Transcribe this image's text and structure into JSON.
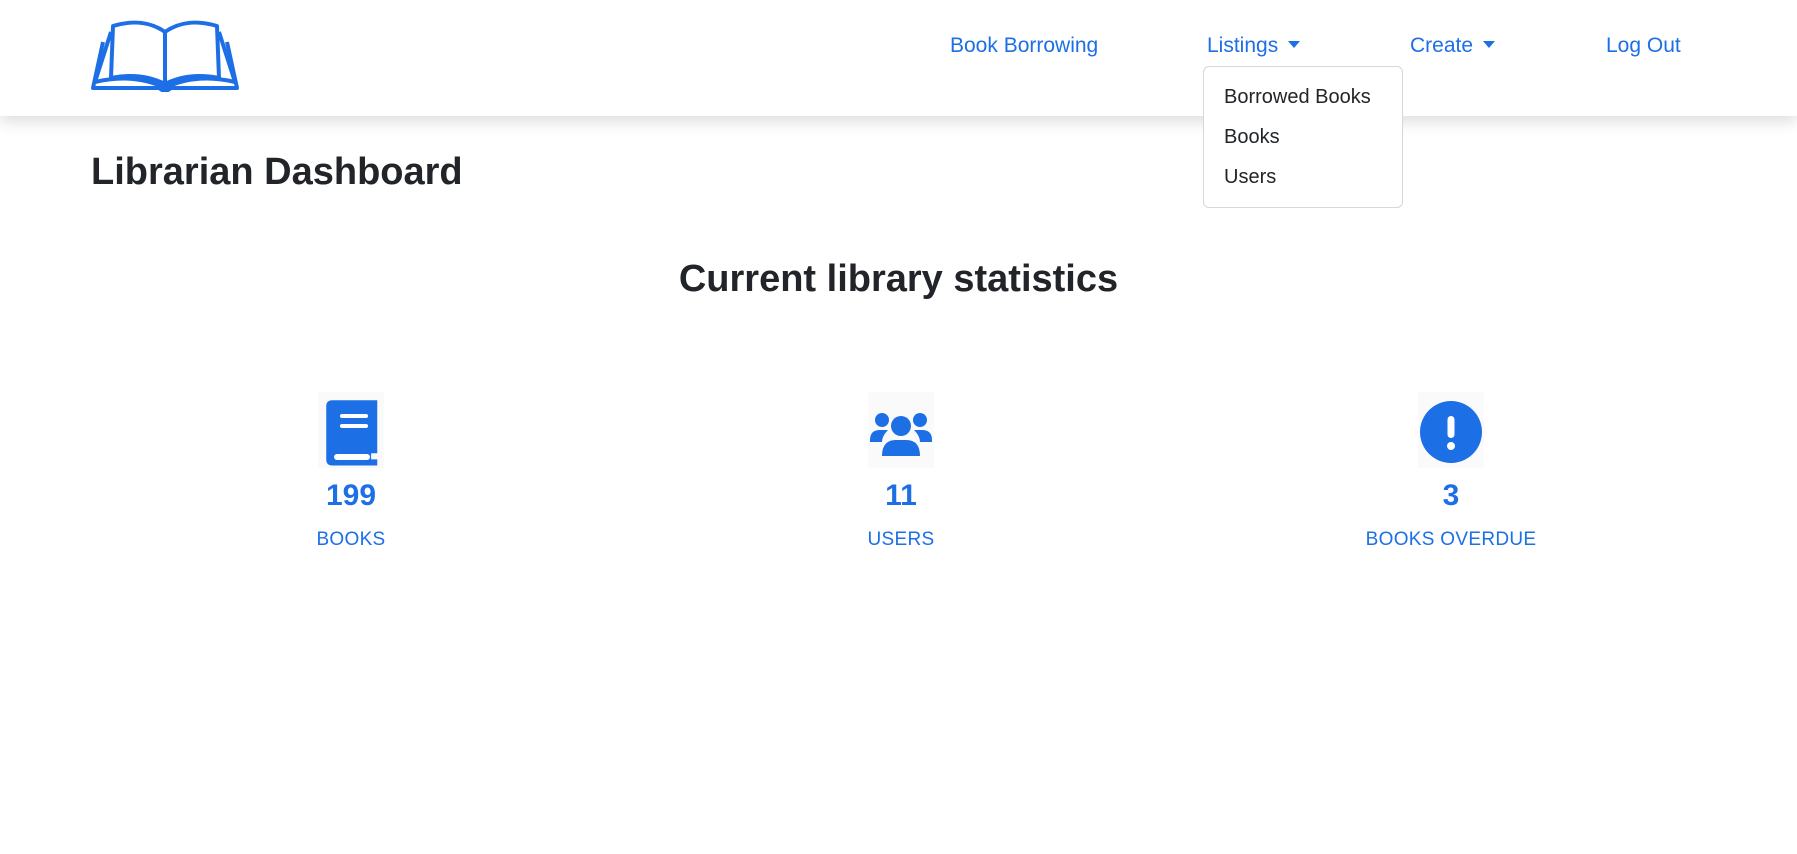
{
  "nav": {
    "items": [
      {
        "label": "Book Borrowing"
      },
      {
        "label": "Listings"
      },
      {
        "label": "Create"
      },
      {
        "label": "Log Out"
      }
    ],
    "logo_icon": "open-book-icon"
  },
  "listings_dropdown": {
    "items": [
      {
        "label": "Borrowed Books"
      },
      {
        "label": "Books"
      },
      {
        "label": "Users"
      }
    ]
  },
  "page": {
    "title": "Librarian Dashboard",
    "section_title": "Current library statistics"
  },
  "stats": [
    {
      "value": "199",
      "label": "BOOKS",
      "icon": "book-icon"
    },
    {
      "value": "11",
      "label": "USERS",
      "icon": "users-icon"
    },
    {
      "value": "3",
      "label": "BOOKS OVERDUE",
      "icon": "exclamation-circle-icon"
    }
  ],
  "colors": {
    "accent": "#1d6fe6",
    "text": "#212529",
    "background": "#ffffff"
  }
}
